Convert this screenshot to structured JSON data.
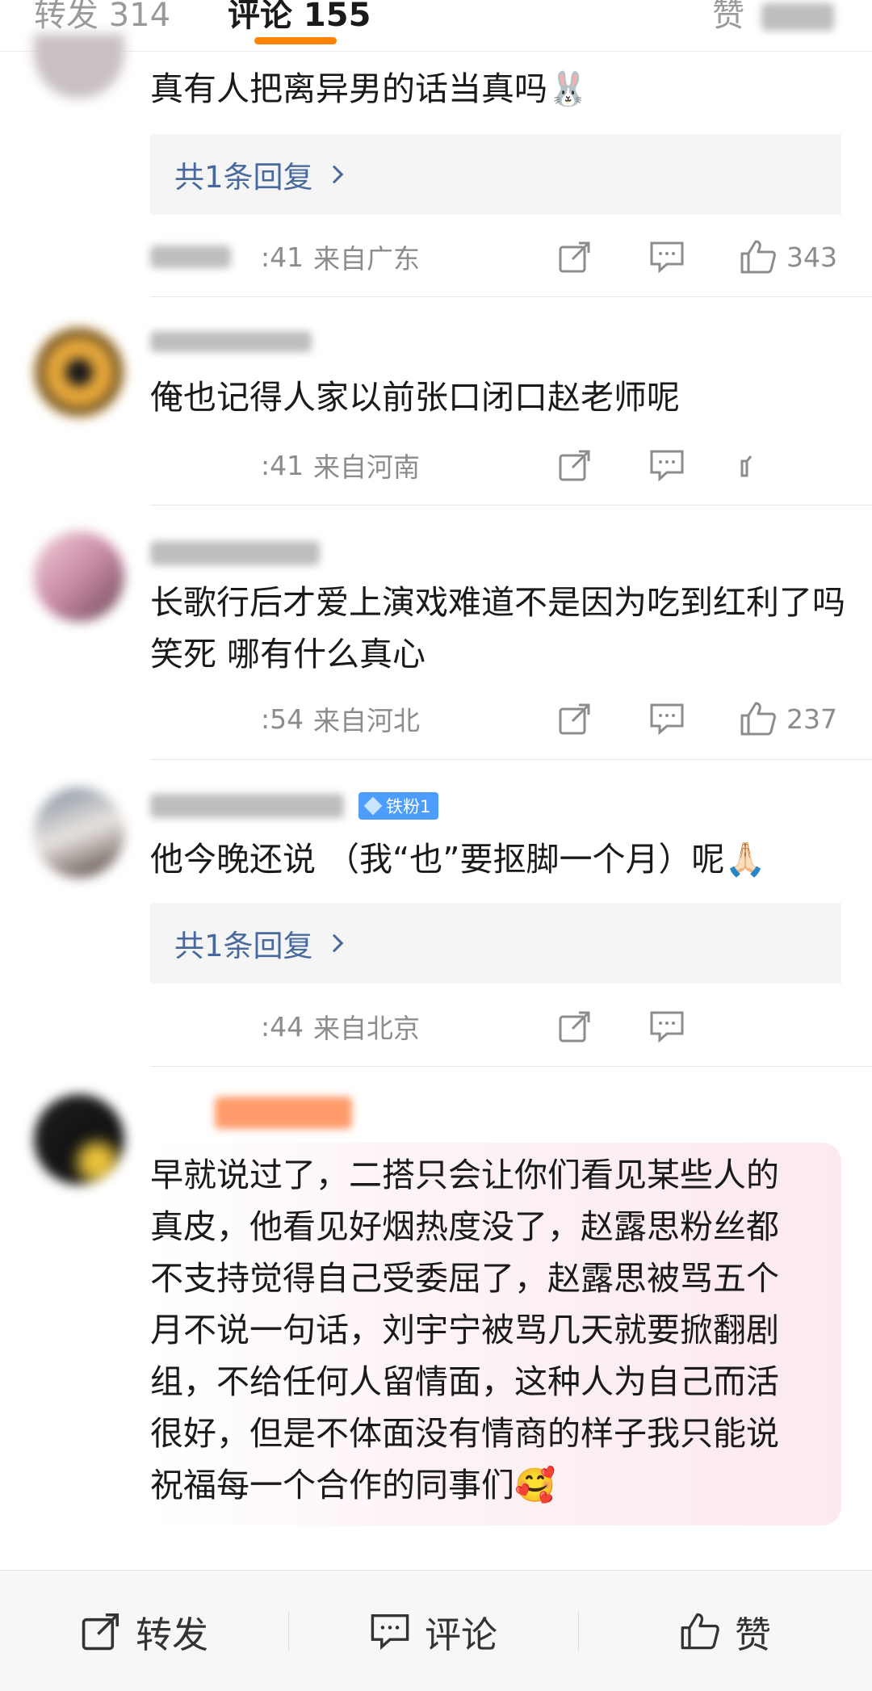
{
  "tabs": {
    "repost": "转发 314",
    "comments": "评论 155",
    "likes": "赞"
  },
  "comments": [
    {
      "text": "真有人把离异男的话当真吗",
      "emoji": "🐰",
      "reply_label": "共1条回复",
      "time": ":41",
      "location": "来自广东",
      "likes": "343"
    },
    {
      "text": "俺也记得人家以前张口闭口赵老师呢",
      "time": ":41",
      "location": "来自河南"
    },
    {
      "text": "长歌行后才爱上演戏难道不是因为吃到红利了吗 笑死 哪有什么真心",
      "time": ":54",
      "location": "来自河北",
      "likes": "237"
    },
    {
      "badge": "铁粉1",
      "text": "他今晚还说 （我“也”要抠脚一个月）呢",
      "emoji": "🙏🏻",
      "reply_label": "共1条回复",
      "time": ":44",
      "location": "来自北京"
    },
    {
      "text": "早就说过了，二搭只会让你们看见某些人的真皮，他看见好烟热度没了，赵露思粉丝都不支持觉得自己受委屈了，赵露思被骂五个月不说一句话，刘宇宁被骂几天就要掀翻剧组，不给任何人留情面，这种人为自己而活很好，但是不体面没有情商的样子我只能说祝福每一个合作的同事们",
      "emoji": "🥰"
    }
  ],
  "bottom_bar": {
    "repost": "转发",
    "comment": "评论",
    "like": "赞"
  },
  "colors": {
    "accent": "#ff8200",
    "link": "#48699e",
    "meta": "#8c8c8c",
    "badge": "#4d9dff"
  },
  "icons": [
    "repost-icon",
    "comment-icon",
    "like-icon",
    "chevron-right-icon",
    "diamond-icon"
  ]
}
